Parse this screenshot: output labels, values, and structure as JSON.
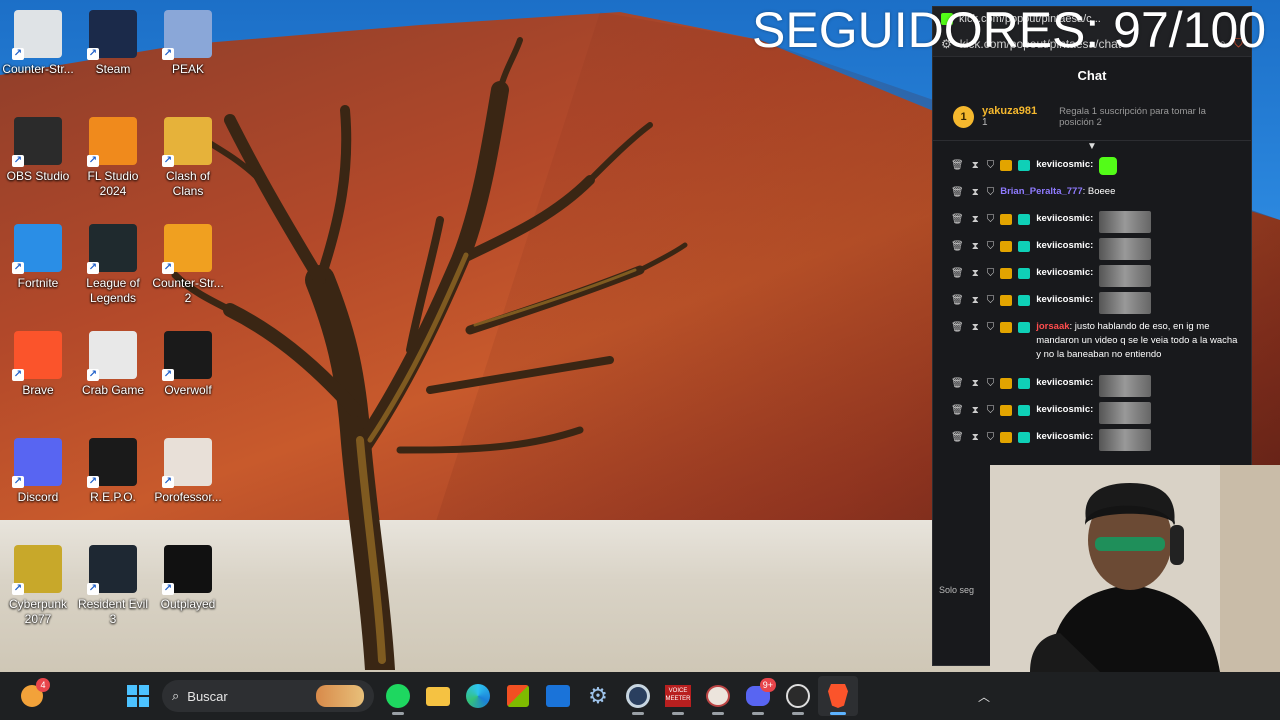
{
  "overlay": {
    "followers_text": "SEGUIDORES: 97/100"
  },
  "desktop": {
    "icons": [
      {
        "label": "Counter-Str...",
        "icon": "counter-strike-icon",
        "color": "#dfe3e6"
      },
      {
        "label": "Steam",
        "icon": "steam-icon",
        "color": "#1b2a4a"
      },
      {
        "label": "PEAK",
        "icon": "peak-icon",
        "color": "#8aa7d8"
      },
      {
        "label": "OBS Studio",
        "icon": "obs-icon",
        "color": "#2b2b2b"
      },
      {
        "label": "FL Studio 2024",
        "icon": "fl-studio-icon",
        "color": "#f08a1c"
      },
      {
        "label": "Clash of Clans",
        "icon": "clash-of-clans-icon",
        "color": "#e6b23a"
      },
      {
        "label": "Fortnite",
        "icon": "fortnite-icon",
        "color": "#2a8ee6"
      },
      {
        "label": "League of Legends",
        "icon": "league-of-legends-icon",
        "color": "#1f2a2e"
      },
      {
        "label": "Counter-Str... 2",
        "icon": "counter-strike-2-icon",
        "color": "#f0a020"
      },
      {
        "label": "Brave",
        "icon": "brave-icon",
        "color": "#fb542b"
      },
      {
        "label": "Crab Game",
        "icon": "crab-game-icon",
        "color": "#e8e8e8"
      },
      {
        "label": "Overwolf",
        "icon": "overwolf-icon",
        "color": "#1a1a1a"
      },
      {
        "label": "Discord",
        "icon": "discord-icon",
        "color": "#5865f2"
      },
      {
        "label": "R.E.P.O.",
        "icon": "repo-icon",
        "color": "#1a1a1a"
      },
      {
        "label": "Porofessor...",
        "icon": "porofessor-icon",
        "color": "#e8e0d8"
      },
      {
        "label": "Cyberpunk 2077",
        "icon": "cyberpunk-icon",
        "color": "#c8a82a"
      },
      {
        "label": "Resident Evil 3",
        "icon": "resident-evil-3-icon",
        "color": "#1e2833"
      },
      {
        "label": "Outplayed",
        "icon": "outplayed-icon",
        "color": "#111111"
      }
    ]
  },
  "popup": {
    "tab_title": "kick.com/popout/pintaesa/c...",
    "url": "kick.com/popout/pintaesa/chat",
    "chat_heading": "Chat",
    "leader": {
      "rank": "1",
      "user": "yakuza981",
      "count": "1",
      "gift_text": "Regala 1 suscripción para tomar la posición 2"
    },
    "messages": [
      {
        "user": "keviicosmic:",
        "user_color": "#ffffff",
        "text": "",
        "content": "emote-green"
      },
      {
        "user": "Brian_Peralta_777",
        "user_color": "#8f7bff",
        "text": ": Boeee",
        "content": "text"
      },
      {
        "user": "keviicosmic:",
        "user_color": "#ffffff",
        "text": "",
        "content": "emote"
      },
      {
        "user": "keviicosmic:",
        "user_color": "#ffffff",
        "text": "",
        "content": "emote"
      },
      {
        "user": "keviicosmic:",
        "user_color": "#ffffff",
        "text": "",
        "content": "emote"
      },
      {
        "user": "keviicosmic:",
        "user_color": "#ffffff",
        "text": "",
        "content": "emote"
      },
      {
        "user": "jorsaak",
        "user_color": "#ff4d4d",
        "text": ": justo hablando de eso, en ig me mandaron un video q se le veia todo a la wacha y no la baneaban no entiendo",
        "content": "text"
      },
      {
        "user": "keviicosmic:",
        "user_color": "#ffffff",
        "text": "",
        "content": "emote"
      },
      {
        "user": "keviicosmic:",
        "user_color": "#ffffff",
        "text": "",
        "content": "emote"
      },
      {
        "user": "keviicosmic:",
        "user_color": "#ffffff",
        "text": "",
        "content": "emote"
      }
    ],
    "footer_text": "Solo seg"
  },
  "taskbar": {
    "search_placeholder": "Buscar",
    "weather_badge": "4",
    "discord_badge": "9+",
    "apps": [
      {
        "name": "windows-start-button",
        "icon": "windows-icon"
      },
      {
        "name": "spotify-button",
        "icon": "spotify-icon"
      },
      {
        "name": "file-explorer-button",
        "icon": "folder-icon"
      },
      {
        "name": "edge-button",
        "icon": "edge-icon"
      },
      {
        "name": "store-button",
        "icon": "store-icon"
      },
      {
        "name": "outlook-button",
        "icon": "outlook-icon"
      },
      {
        "name": "settings-button",
        "icon": "gear-icon"
      },
      {
        "name": "steam-taskbar-button",
        "icon": "steam-icon"
      },
      {
        "name": "voicemeeter-button",
        "icon": "voicemeeter-icon"
      },
      {
        "name": "porofessor-taskbar-button",
        "icon": "porofessor-icon"
      },
      {
        "name": "discord-taskbar-button",
        "icon": "discord-icon"
      },
      {
        "name": "obs-taskbar-button",
        "icon": "obs-icon"
      },
      {
        "name": "brave-taskbar-button",
        "icon": "brave-icon"
      }
    ],
    "voicemeeter_label": "VOICE\nMEETER"
  }
}
